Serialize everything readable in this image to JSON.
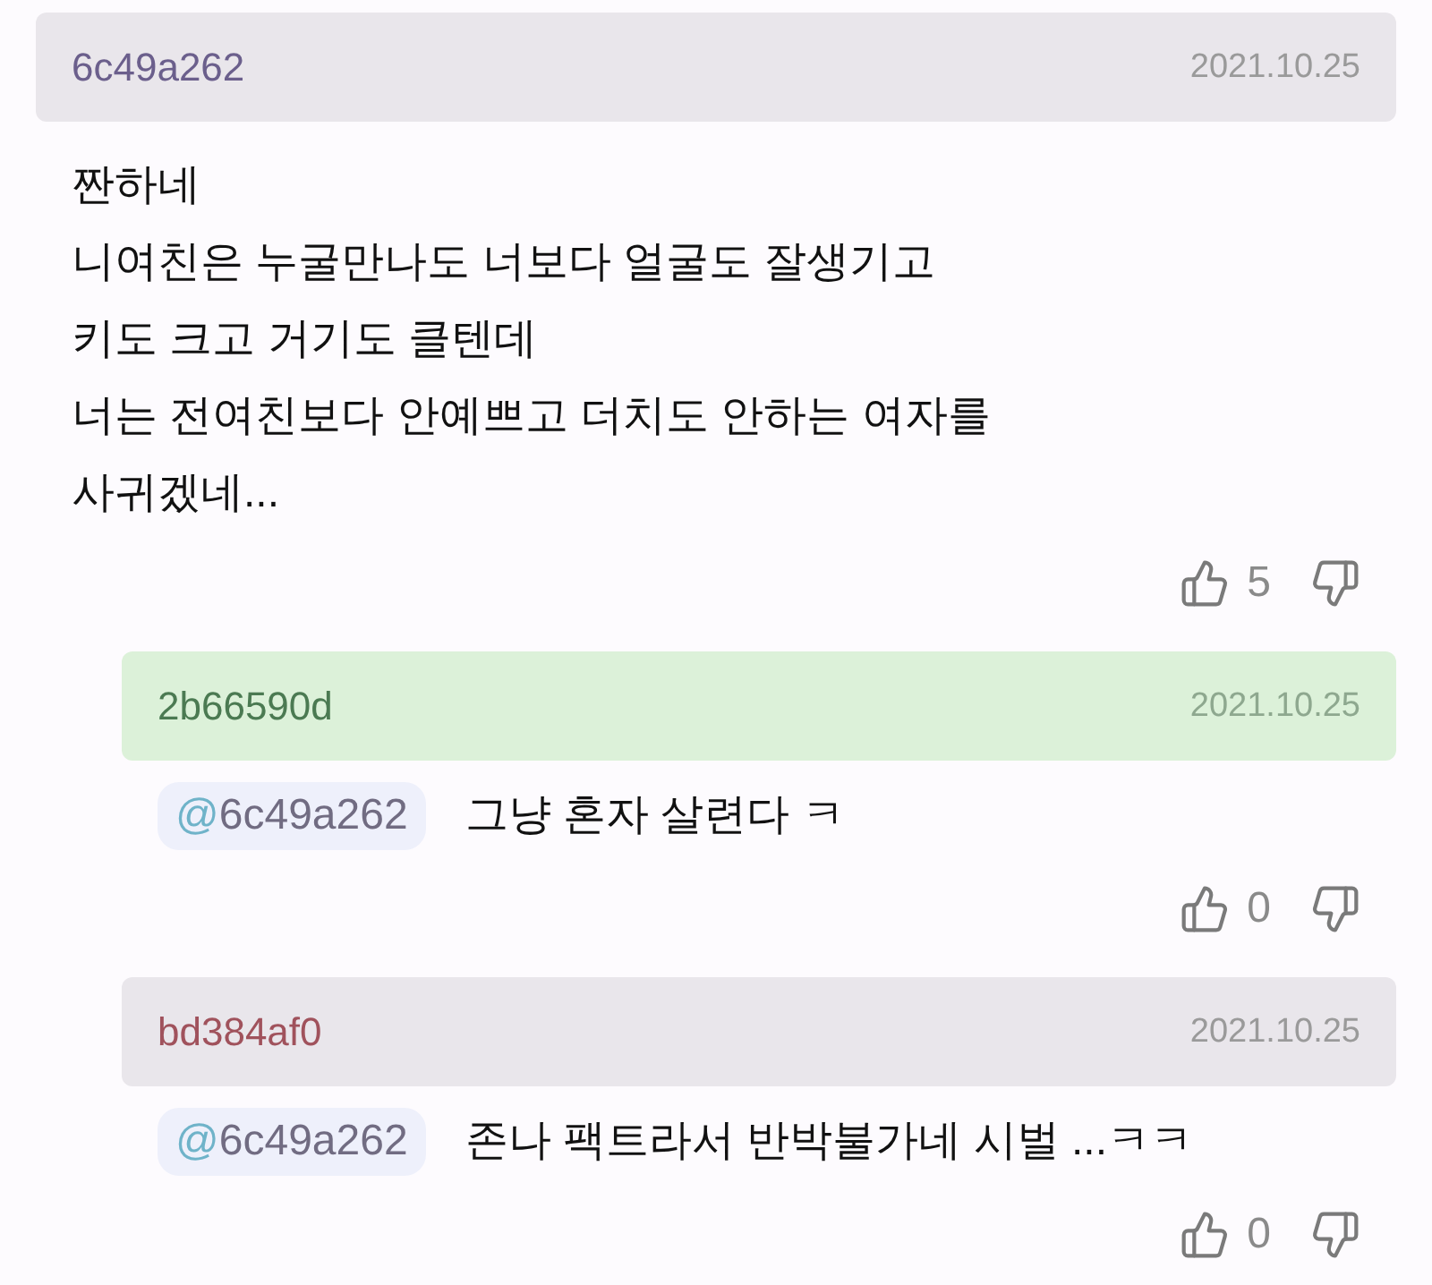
{
  "comments": [
    {
      "user": "6c49a262",
      "color": "#6b5f8c",
      "highlighted": false,
      "date": "2021.10.25",
      "text": "짠하네\n니여친은 누굴만나도 너보다 얼굴도 잘생기고\n키도 크고 거기도 클텐데\n너는 전여친보다 안예쁘고 더치도 안하는 여자를\n사귀겠네...",
      "likes": "5",
      "replies": [
        {
          "user": "2b66590d",
          "color": "#4b7a52",
          "highlighted": true,
          "date": "2021.10.25",
          "mention": "@6c49a262",
          "text": "그냥 혼자 살련다 ㅋ",
          "likes": "0"
        },
        {
          "user": "bd384af0",
          "color": "#a0525c",
          "highlighted": false,
          "date": "2021.10.25",
          "mention": "@6c49a262",
          "text": "존나 팩트라서 반박불가네 시벌 ...ㅋㅋ",
          "likes": "0"
        }
      ]
    }
  ]
}
